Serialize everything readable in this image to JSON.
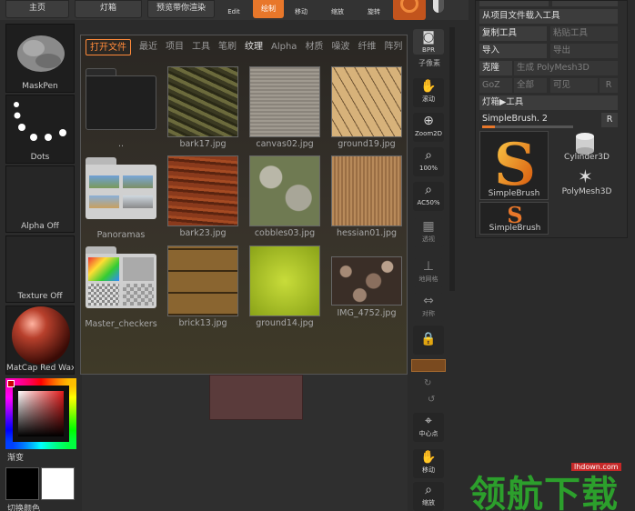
{
  "topbar": {
    "btn1": "主页",
    "btn2": "灯箱",
    "btn3": "预览带你渲染",
    "edit": "Edit",
    "draw": "绘制",
    "move": "移动",
    "scale": "缩放",
    "rotate": "旋转"
  },
  "shelf": {
    "brush": "MaskPen",
    "stroke": "Dots",
    "alpha": "Alpha Off",
    "texture": "Texture Off",
    "material": "MatCap Red Wax",
    "gradient": "渐变",
    "switch_color": "切换颜色"
  },
  "browser": {
    "tabs": [
      "打开文件",
      "最近",
      "项目",
      "工具",
      "笔刷",
      "纹理",
      "Alpha",
      "材质",
      "噪波",
      "纤维",
      "阵列"
    ],
    "items": [
      {
        "label": ".."
      },
      {
        "label": "bark17.jpg"
      },
      {
        "label": "canvas02.jpg"
      },
      {
        "label": "ground19.jpg"
      },
      {
        "label": "Panoramas"
      },
      {
        "label": "bark23.jpg"
      },
      {
        "label": "cobbles03.jpg"
      },
      {
        "label": "hessian01.jpg"
      },
      {
        "label": "Master_checkers"
      },
      {
        "label": "brick13.jpg"
      },
      {
        "label": "ground14.jpg"
      },
      {
        "label": "IMG_4752.jpg"
      }
    ]
  },
  "dock": {
    "bpr": "BPR",
    "subpixel": "子像素",
    "scroll": "滚动",
    "zoom2d": "Zoom2D",
    "pct100": "100%",
    "ac50": "AC50%",
    "perspective": "透视",
    "floor": "地网格",
    "symmetry": "对称",
    "centerpoint": "中心点",
    "move": "移动",
    "scale": "缩放"
  },
  "tool": {
    "load_project_tool": "从项目文件载入工具",
    "copy_tool": "复制工具",
    "paste_tool": "粘贴工具",
    "import": "导入",
    "export": "导出",
    "clone": "克隆",
    "make_polymesh": "生成 PolyMesh3D",
    "goz": "GoZ",
    "all": "全部",
    "visible": "可见",
    "r": "R",
    "lightbox_tools": "灯箱▶工具",
    "current": "SimpleBrush. 2",
    "items": [
      "SimpleBrush",
      "Cylinder3D",
      "PolyMesh3D",
      "SimpleBrush"
    ]
  },
  "watermark": {
    "text": "领航下载",
    "url": "lhdown.com"
  },
  "colors": {
    "accent": "#e8772a",
    "tab_active": "#ff8a3a"
  }
}
